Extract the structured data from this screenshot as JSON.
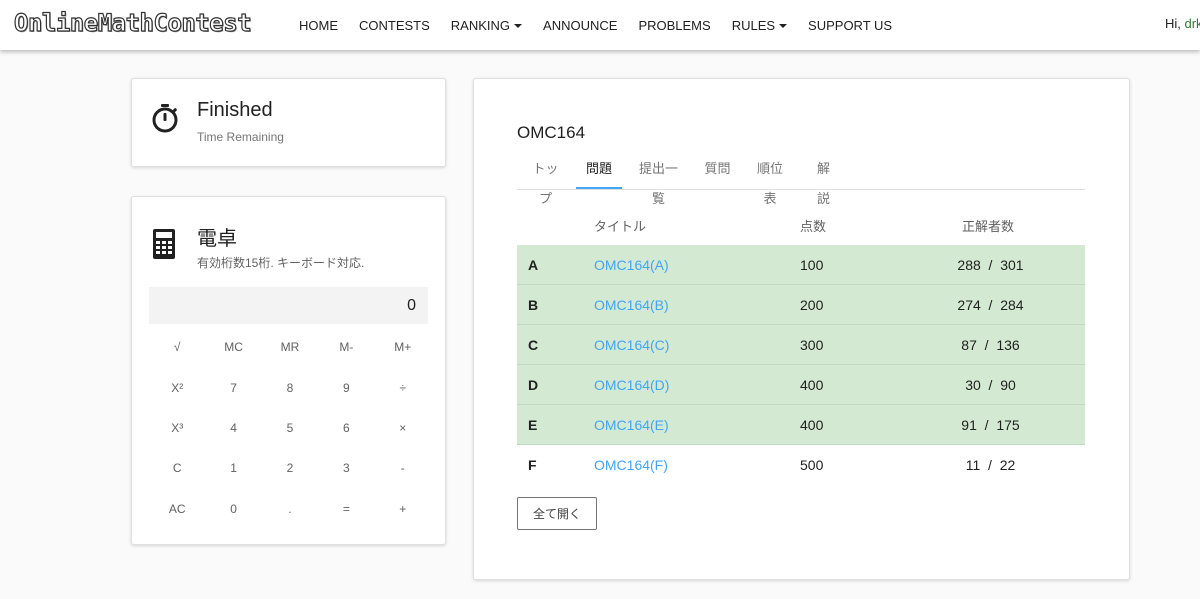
{
  "navbar": {
    "brand": "OnlineMathContest",
    "items": [
      {
        "label": "HOME",
        "dropdown": false
      },
      {
        "label": "CONTESTS",
        "dropdown": false
      },
      {
        "label": "RANKING",
        "dropdown": true
      },
      {
        "label": "ANNOUNCE",
        "dropdown": false
      },
      {
        "label": "PROBLEMS",
        "dropdown": false
      },
      {
        "label": "RULES",
        "dropdown": true
      },
      {
        "label": "SUPPORT US",
        "dropdown": false
      }
    ],
    "greeting": "Hi, ",
    "username": "drk"
  },
  "timer": {
    "icon": "stopwatch-icon",
    "status": "Finished",
    "subtitle": "Time Remaining"
  },
  "calculator": {
    "icon": "calculator-icon",
    "title": "電卓",
    "subtitle": "有効桁数15桁. キーボード対応.",
    "display": "0",
    "keys": [
      "√",
      "MC",
      "MR",
      "M-",
      "M+",
      "X²",
      "7",
      "8",
      "9",
      "÷",
      "X³",
      "4",
      "5",
      "6",
      "×",
      "C",
      "1",
      "2",
      "3",
      "-",
      "AC",
      "0",
      ".",
      "=",
      "+"
    ]
  },
  "contest": {
    "title": "OMC164",
    "tabs": [
      {
        "label": "トップ",
        "active": false
      },
      {
        "label": "問題",
        "active": true
      },
      {
        "label": "提出一覧",
        "active": false
      },
      {
        "label": "質問",
        "active": false
      },
      {
        "label": "順位表",
        "active": false
      },
      {
        "label": "解説",
        "active": false
      }
    ],
    "table_headers": {
      "title": "タイトル",
      "points": "点数",
      "solvers": "正解者数"
    },
    "problems": [
      {
        "label": "A",
        "title": "OMC164(A)",
        "points": "100",
        "solved": "288",
        "attempted": "301",
        "is_solved": true
      },
      {
        "label": "B",
        "title": "OMC164(B)",
        "points": "200",
        "solved": "274",
        "attempted": "284",
        "is_solved": true
      },
      {
        "label": "C",
        "title": "OMC164(C)",
        "points": "300",
        "solved": "87",
        "attempted": "136",
        "is_solved": true
      },
      {
        "label": "D",
        "title": "OMC164(D)",
        "points": "400",
        "solved": "30",
        "attempted": "90",
        "is_solved": true
      },
      {
        "label": "E",
        "title": "OMC164(E)",
        "points": "400",
        "solved": "91",
        "attempted": "175",
        "is_solved": true
      },
      {
        "label": "F",
        "title": "OMC164(F)",
        "points": "500",
        "solved": "11",
        "attempted": "22",
        "is_solved": false
      }
    ],
    "expand_all": "全て開く"
  },
  "colors": {
    "solved_row": "#d4e9d2",
    "link": "#42a5f5",
    "tab_indicator": "#42a5f5",
    "username": "#2e7d32"
  }
}
